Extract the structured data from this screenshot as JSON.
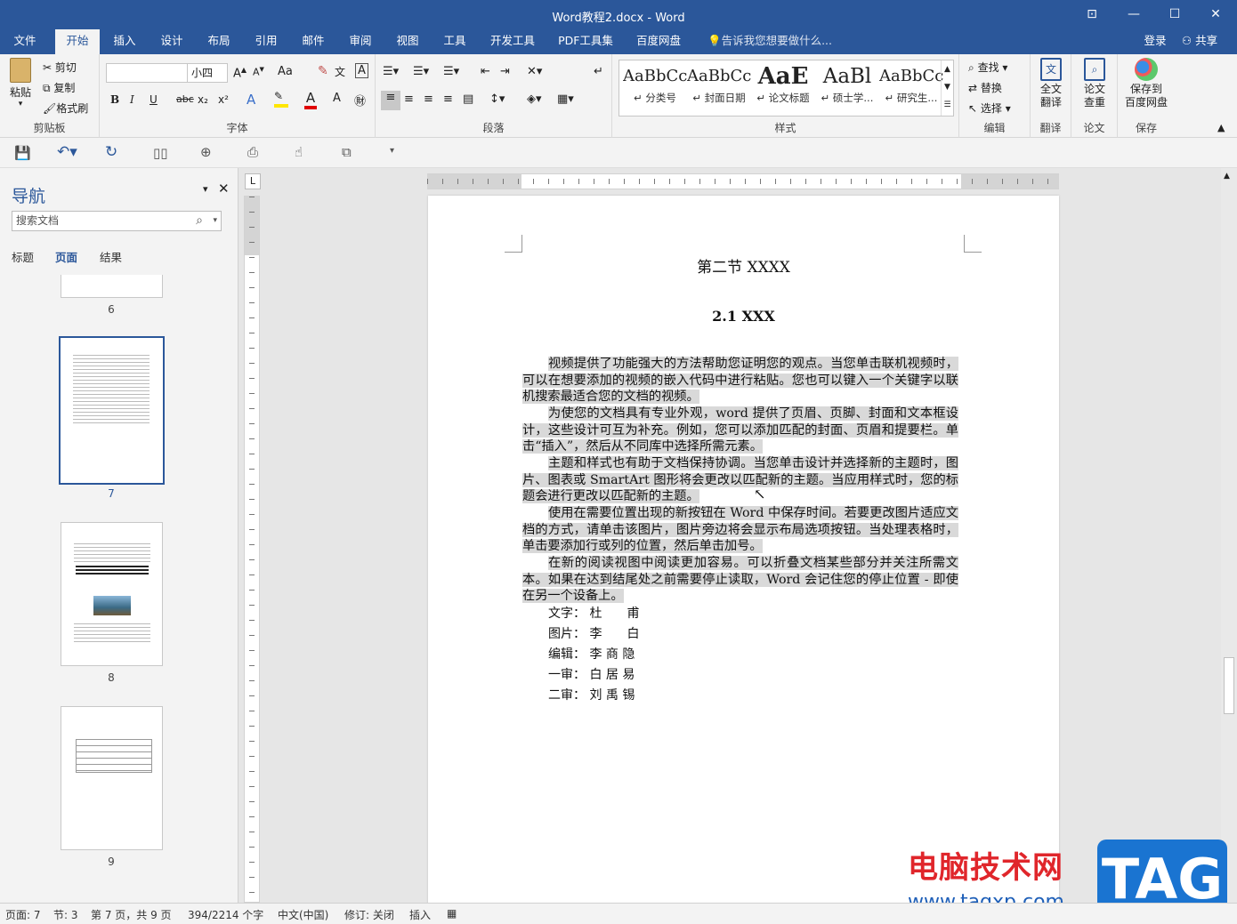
{
  "window": {
    "title": "Word教程2.docx - Word"
  },
  "tabs": [
    "文件",
    "开始",
    "插入",
    "设计",
    "布局",
    "引用",
    "邮件",
    "审阅",
    "视图",
    "工具",
    "开发工具",
    "PDF工具集",
    "百度网盘"
  ],
  "tell_me": "告诉我您想要做什么...",
  "account": {
    "login": "登录",
    "share": "共享"
  },
  "clipboard": {
    "paste": "粘贴",
    "cut": "剪切",
    "copy": "复制",
    "format_painter": "格式刷",
    "label": "剪贴板"
  },
  "font": {
    "name": "",
    "size": "小四",
    "label": "字体",
    "bold": "B",
    "italic": "I",
    "underline": "U",
    "strike": "abc",
    "sub": "x₂",
    "sup": "x²",
    "aa": "Aa"
  },
  "paragraph": {
    "label": "段落"
  },
  "styles": {
    "label": "样式",
    "items": [
      {
        "sample": "AaBbCc",
        "name": "↵ 分类号"
      },
      {
        "sample": "AaBbCc",
        "name": "↵ 封面日期"
      },
      {
        "sample": "AaE",
        "name": "↵ 论文标题"
      },
      {
        "sample": "AaBl",
        "name": "↵ 硕士学..."
      },
      {
        "sample": "AaBbCc",
        "name": "↵ 研究生..."
      }
    ]
  },
  "editing": {
    "find": "查找",
    "replace": "替换",
    "select": "选择",
    "label": "编辑"
  },
  "translate": {
    "button": "全文\n翻译",
    "label": "翻译"
  },
  "paper": {
    "button": "论文\n查重",
    "label": "论文"
  },
  "save": {
    "button": "保存到\n百度网盘",
    "label": "保存"
  },
  "nav": {
    "title": "导航",
    "search_placeholder": "搜索文档",
    "tabs": [
      "标题",
      "页面",
      "结果"
    ],
    "pages": [
      "6",
      "7",
      "8",
      "9"
    ]
  },
  "document": {
    "section_title": "第二节  XXXX",
    "subsection": "2.1 XXX",
    "paragraphs": [
      "视频提供了功能强大的方法帮助您证明您的观点。当您单击联机视频时，可以在想要添加的视频的嵌入代码中进行粘贴。您也可以键入一个关键字以联机搜索最适合您的文档的视频。",
      "为使您的文档具有专业外观，word 提供了页眉、页脚、封面和文本框设计，这些设计可互为补充。例如，您可以添加匹配的封面、页眉和提要栏。单击“插入”，然后从不同库中选择所需元素。",
      "主题和样式也有助于文档保持协调。当您单击设计并选择新的主题时，图片、图表或 SmartArt 图形将会更改以匹配新的主题。当应用样式时，您的标题会进行更改以匹配新的主题。",
      "使用在需要位置出现的新按钮在 Word 中保存时间。若要更改图片适应文档的方式，请单击该图片，图片旁边将会显示布局选项按钮。当处理表格时，单击要添加行或列的位置，然后单击加号。",
      "在新的阅读视图中阅读更加容易。可以折叠文档某些部分并关注所需文本。如果在达到结尾处之前需要停止读取，Word 会记住您的停止位置 - 即使在另一个设备上。"
    ],
    "credits": [
      {
        "role": "文字：",
        "name": "杜　　甫"
      },
      {
        "role": "图片：",
        "name": "李　　白"
      },
      {
        "role": "编辑：",
        "name": "李 商 隐"
      },
      {
        "role": "一审：",
        "name": "白 居 易"
      },
      {
        "role": "二审：",
        "name": "刘 禹 锡"
      }
    ]
  },
  "status": {
    "page": "页面: 7",
    "section": "节: 3",
    "page_of": "第 7 页，共 9 页",
    "words": "394/2214 个字",
    "lang": "中文(中国)",
    "track": "修订: 关闭",
    "mode": "插入"
  },
  "watermark": {
    "cn": "电脑技术网",
    "url": "www.tagxp.com",
    "tag": "TAG"
  },
  "colors": {
    "brand": "#2b579a",
    "highlight": "#d9d9d9"
  }
}
